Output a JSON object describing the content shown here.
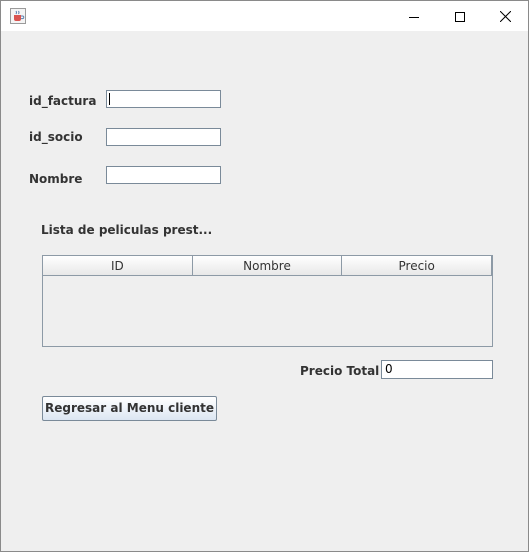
{
  "form": {
    "id_factura_label": "id_factura",
    "id_factura_value": "",
    "id_socio_label": "id_socio",
    "id_socio_value": "",
    "nombre_label": "Nombre",
    "nombre_value": ""
  },
  "list": {
    "title": "Lista de peliculas prest...",
    "columns": [
      "ID",
      "Nombre",
      "Precio"
    ],
    "rows": []
  },
  "total": {
    "label": "Precio Total",
    "value": "0"
  },
  "buttons": {
    "back_label": "Regresar al Menu cliente"
  },
  "icons": {
    "app": "java-coffee-cup-icon",
    "minimize": "minimize-icon",
    "maximize": "maximize-icon",
    "close": "close-icon"
  }
}
